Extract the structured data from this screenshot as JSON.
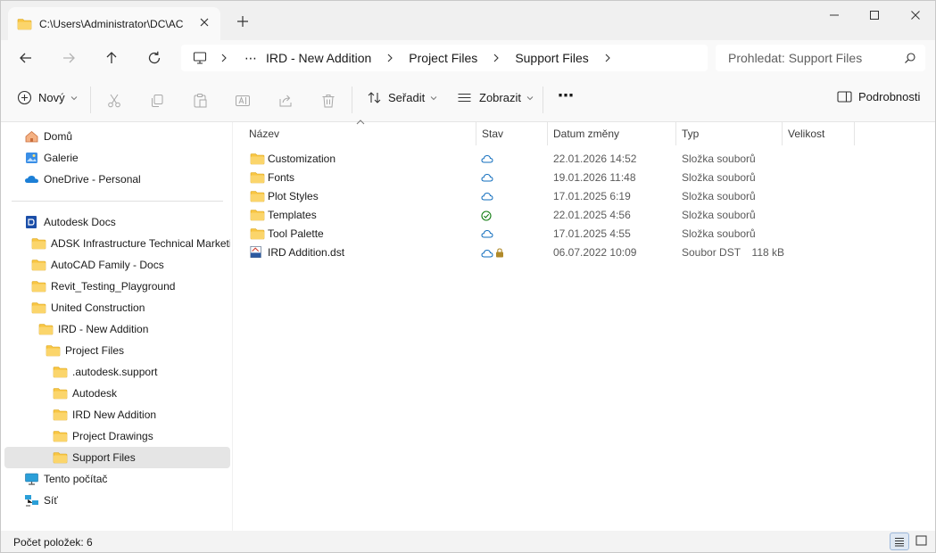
{
  "tab": {
    "title": "C:\\Users\\Administrator\\DC\\AC"
  },
  "address": {
    "segments": [
      "IRD - New Addition",
      "Project Files",
      "Support Files"
    ],
    "overflow": "⋯"
  },
  "search": {
    "placeholder": "Prohledat: Support Files"
  },
  "toolbar": {
    "new_label": "Nový",
    "sort_label": "Seřadit",
    "view_label": "Zobrazit",
    "more_label": "⋯",
    "details_label": "Podrobnosti"
  },
  "sidebar": {
    "items": [
      {
        "label": "Domů",
        "icon": "home-icon"
      },
      {
        "label": "Galerie",
        "icon": "gallery-icon"
      },
      {
        "label": "OneDrive - Personal",
        "icon": "onedrive-icon"
      },
      {
        "label": "Autodesk Docs",
        "icon": "autodesk-docs-icon"
      },
      {
        "label": "ADSK Infrastructure Technical Marketing",
        "icon": "folder-icon"
      },
      {
        "label": "AutoCAD Family - Docs",
        "icon": "folder-icon"
      },
      {
        "label": "Revit_Testing_Playground",
        "icon": "folder-icon"
      },
      {
        "label": "United Construction",
        "icon": "folder-icon"
      },
      {
        "label": "IRD - New Addition",
        "icon": "folder-icon"
      },
      {
        "label": "Project Files",
        "icon": "folder-icon"
      },
      {
        "label": ".autodesk.support",
        "icon": "folder-icon"
      },
      {
        "label": "Autodesk",
        "icon": "folder-icon"
      },
      {
        "label": "IRD New Addition",
        "icon": "folder-icon"
      },
      {
        "label": "Project Drawings",
        "icon": "folder-icon"
      },
      {
        "label": "Support Files",
        "icon": "folder-icon"
      },
      {
        "label": "Tento počítač",
        "icon": "this-pc-icon"
      },
      {
        "label": "Síť",
        "icon": "network-icon"
      }
    ]
  },
  "columns": {
    "name": "Název",
    "status": "Stav",
    "modified": "Datum změny",
    "type": "Typ",
    "size": "Velikost"
  },
  "files": [
    {
      "name": "Customization",
      "status": "cloud",
      "modified": "22.01.2026 14:52",
      "type": "Složka souborů",
      "size": ""
    },
    {
      "name": "Fonts",
      "status": "cloud",
      "modified": "19.01.2026 11:48",
      "type": "Složka souborů",
      "size": ""
    },
    {
      "name": "Plot Styles",
      "status": "cloud",
      "modified": "17.01.2025 6:19",
      "type": "Složka souborů",
      "size": ""
    },
    {
      "name": "Templates",
      "status": "synced",
      "modified": "22.01.2025 4:56",
      "type": "Složka souborů",
      "size": ""
    },
    {
      "name": "Tool Palette",
      "status": "cloud",
      "modified": "17.01.2025 4:55",
      "type": "Složka souborů",
      "size": ""
    },
    {
      "name": "IRD Addition.dst",
      "status": "cloud-locked",
      "modified": "06.07.2022 10:09",
      "type": "Soubor DST",
      "size": "118 kB"
    }
  ],
  "status": {
    "item_count": "Počet položek: 6"
  },
  "colors": {
    "accent": "#0067c0",
    "folder": "#f8c542",
    "cloud": "#0f6cbd",
    "synced": "#107c10",
    "lock": "#b08a2a"
  }
}
